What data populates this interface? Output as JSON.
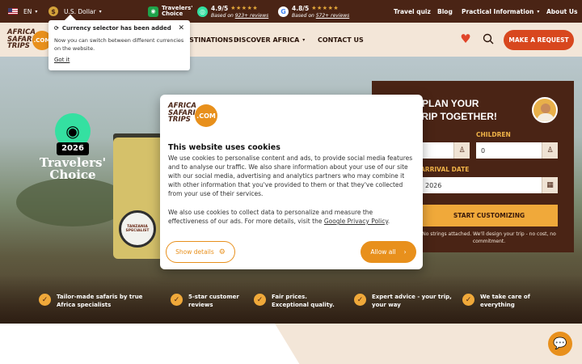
{
  "topbar": {
    "language": "EN",
    "currency": "U.S. Dollar",
    "currency_symbol": "$",
    "travelers_choice": "Travelers' Choice",
    "tripadvisor": {
      "score": "4.9/5",
      "based_on": "Based on",
      "reviews": "923+ reviews"
    },
    "google": {
      "score": "4.8/5",
      "based_on": "Based on",
      "reviews": "572+ reviews"
    },
    "nav": [
      "Travel quiz",
      "Blog",
      "Practical Information",
      "About Us"
    ],
    "stars": "★★★★★"
  },
  "logo": {
    "line1": "AFRICA",
    "line2": "SAFARI",
    "line3": "TRIPS",
    "suffix": ".COM"
  },
  "mainnav": {
    "items": [
      "DESTINATIONS",
      "DISCOVER AFRICA",
      "CONTACT US"
    ],
    "request_button": "MAKE A REQUEST"
  },
  "currency_popup": {
    "title": "Currency selector has been added",
    "body": "Now you can switch between different currencies on the website.",
    "got_it": "Got it"
  },
  "hero": {
    "award_year": "2026",
    "award_title": "Travelers' Choice",
    "spare_tire": "TANZANIA SPECIALIST"
  },
  "plan": {
    "title_line1": "PLAN YOUR",
    "title_line2": "TRIP TOGETHER!",
    "children_label": "CHILDREN",
    "adults_value": "",
    "children_value": "0",
    "arrival_label": "ARRIVAL DATE",
    "arrival_value": "2026",
    "start_button": "START CUSTOMIZING",
    "note": "No strings attached. We'll design your trip - no cost, no commitment."
  },
  "features": [
    {
      "line1": "Tailor-made safaris by true",
      "line2": "Africa specialists"
    },
    {
      "line1": "5-star customer",
      "line2": "reviews"
    },
    {
      "line1": "Fair prices.",
      "line2": "Exceptional quality."
    },
    {
      "line1": "Expert advice - your trip,",
      "line2": "your way"
    },
    {
      "line1": "We take care of",
      "line2": "everything"
    }
  ],
  "cookie": {
    "title": "This website uses cookies",
    "p1": "We use cookies to personalise content and ads, to provide social media features and to analyse our traffic. We also share information about your use of our site with our social media, advertising and analytics partners who may combine it with other information that you've provided to them or that they've collected from your use of their services.",
    "p2_prefix": "We also use cookies to collect data to personalize and measure the effectiveness of our ads. For more details, visit the",
    "p2_link": "Google Privacy Policy",
    "show_details": "Show details",
    "allow_all": "Allow all"
  }
}
